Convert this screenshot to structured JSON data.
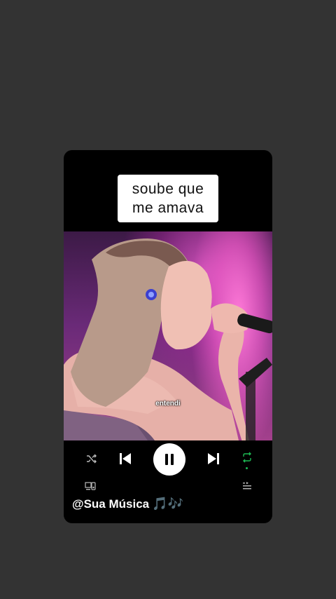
{
  "caption": {
    "line1": "soube que",
    "line2": "me amava"
  },
  "video": {
    "subtitle": "entendi"
  },
  "player": {
    "state": "playing",
    "icons": {
      "shuffle": "shuffle-icon",
      "previous": "skip-previous-icon",
      "play_pause": "pause-icon",
      "next": "skip-next-icon",
      "repeat": "repeat-icon",
      "devices": "devices-icon",
      "queue": "queue-icon"
    },
    "colors": {
      "repeat_active": "#1db954",
      "card_background": "#000000",
      "page_background": "#333333"
    }
  },
  "footer": {
    "handle": "@Sua Música",
    "emoji": "🎵🎶"
  }
}
